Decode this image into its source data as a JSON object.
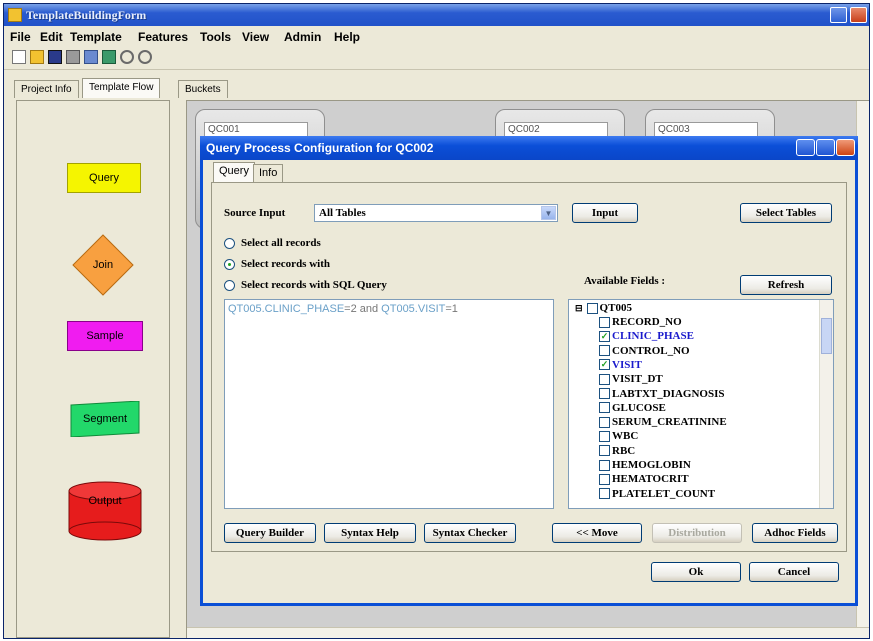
{
  "window": {
    "title": "TemplateBuildingForm"
  },
  "menu": [
    "File",
    "Edit",
    "Template",
    "Features",
    "Tools",
    "View",
    "Admin",
    "Help"
  ],
  "main_tabs": [
    "Project Info",
    "Template Flow",
    "Buckets"
  ],
  "palette": {
    "query": "Query",
    "join": "Join",
    "sample": "Sample",
    "segment": "Segment",
    "output": "Output"
  },
  "buckets": [
    "QC001",
    "QC002",
    "QC003"
  ],
  "dialog": {
    "title": "Query Process Configuration for QC002",
    "tabs": [
      "Query",
      "Info"
    ],
    "source_input_label": "Source Input",
    "source_input_value": "All Tables",
    "input_button": "Input",
    "select_tables_button": "Select Tables",
    "radios": [
      {
        "label": "Select all records",
        "selected": false
      },
      {
        "label": "Select records with",
        "selected": true
      },
      {
        "label": "Select records with SQL Query",
        "selected": false
      }
    ],
    "available_fields_label": "Available Fields :",
    "refresh_button": "Refresh",
    "sql": {
      "t1": "QT005.CLINIC_PHASE",
      "op1": "=2 and ",
      "t2": "QT005.VISIT",
      "op2": "=1"
    },
    "tree_root": "QT005",
    "fields": [
      {
        "name": "RECORD_NO",
        "checked": false
      },
      {
        "name": "CLINIC_PHASE",
        "checked": true
      },
      {
        "name": "CONTROL_NO",
        "checked": false
      },
      {
        "name": "VISIT",
        "checked": true
      },
      {
        "name": "VISIT_DT",
        "checked": false
      },
      {
        "name": "LABTXT_DIAGNOSIS",
        "checked": false
      },
      {
        "name": "GLUCOSE",
        "checked": false
      },
      {
        "name": "SERUM_CREATININE",
        "checked": false
      },
      {
        "name": "WBC",
        "checked": false
      },
      {
        "name": "RBC",
        "checked": false
      },
      {
        "name": "HEMOGLOBIN",
        "checked": false
      },
      {
        "name": "HEMATOCRIT",
        "checked": false
      },
      {
        "name": "PLATELET_COUNT",
        "checked": false
      }
    ],
    "buttons": {
      "query_builder": "Query Builder",
      "syntax_help": "Syntax Help",
      "syntax_checker": "Syntax Checker",
      "move": "<< Move",
      "distribution": "Distribution",
      "adhoc_fields": "Adhoc Fields",
      "ok": "Ok",
      "cancel": "Cancel"
    }
  },
  "colors": {
    "query_shape": "#f5f500",
    "join_shape": "#f8a040",
    "sample_shape": "#f01cf0",
    "segment_shape": "#22d86a",
    "output_shape": "#e61c1c",
    "title_bar": "#0a4fd6"
  }
}
